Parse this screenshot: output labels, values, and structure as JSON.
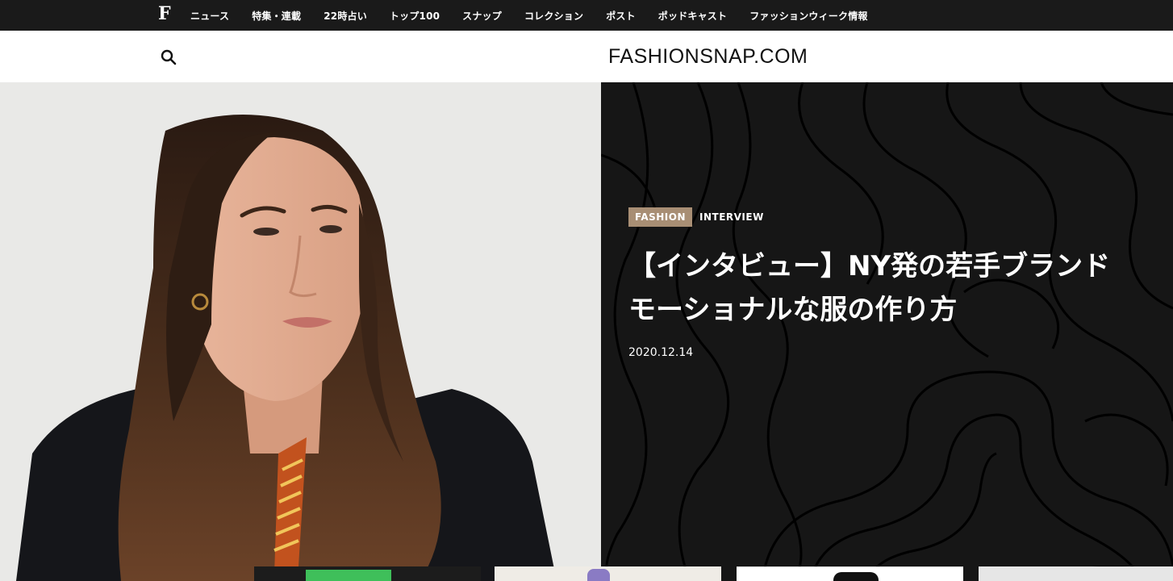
{
  "topbar": {
    "logo": "F",
    "nav": [
      "ニュース",
      "特集・連載",
      "22時占い",
      "トップ100",
      "スナップ",
      "コレクション",
      "ポスト",
      "ポッドキャスト",
      "ファッションウィーク情報"
    ]
  },
  "header": {
    "brand": "FASHIONSNAP.COM",
    "search_icon": "search-icon"
  },
  "hero": {
    "category": "FASHION",
    "subcategory": "INTERVIEW",
    "title_line1": "【インタビュー】NY発の若手ブランド",
    "title_line2": "モーショナルな服の作り方",
    "date": "2020.12.14"
  },
  "colors": {
    "topbar_bg": "#1a1a1a",
    "hero_panel_bg": "#161616",
    "category_tag": "#a88e74"
  }
}
